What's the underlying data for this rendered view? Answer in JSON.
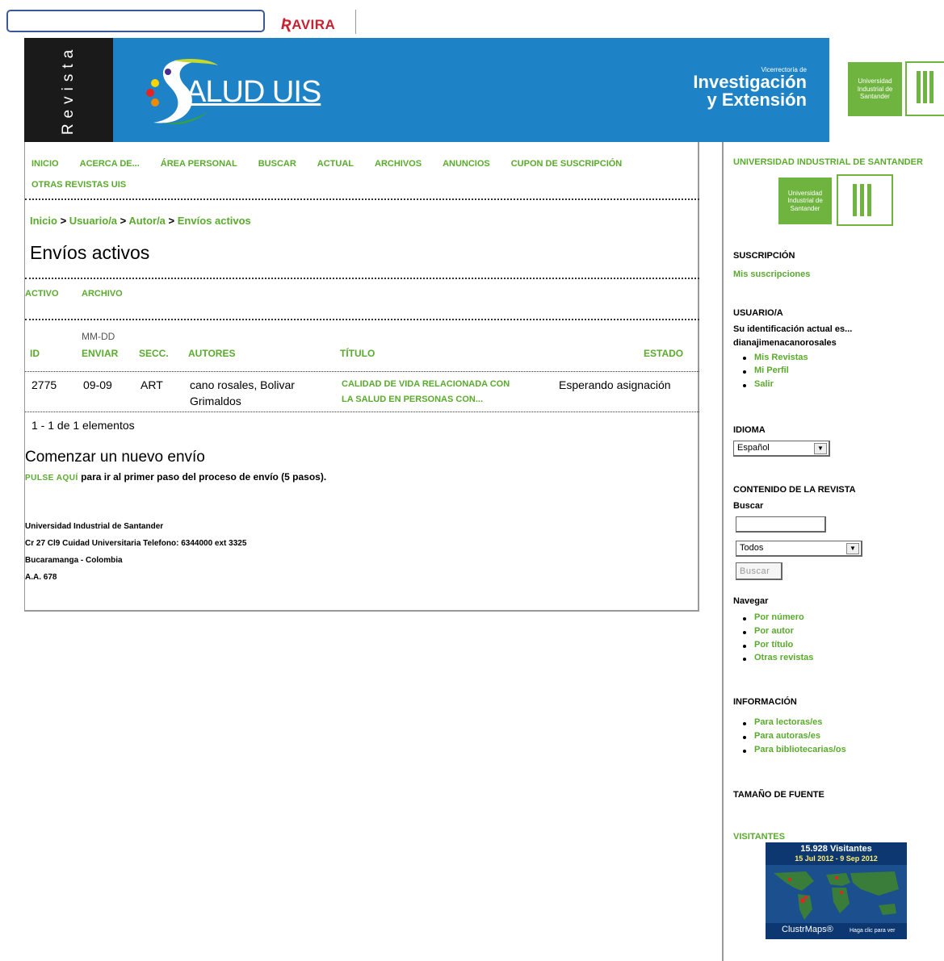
{
  "toolbar": {
    "search_value": "",
    "brand": "AVIRA",
    "brand_initial": "Ʀ"
  },
  "header": {
    "revista": "Revista",
    "logo_text": "ALUD UIS",
    "vie_small": "Vicerrectoría de",
    "vie_line1": "Investigación",
    "vie_line2": "y Extensión",
    "uis_logo": [
      "Universidad",
      "Industrial de",
      "Santander"
    ]
  },
  "nav": [
    "INICIO",
    "ACERCA DE...",
    "ÁREA PERSONAL",
    "BUSCAR",
    "ACTUAL",
    "ARCHIVOS",
    "ANUNCIOS",
    "CUPON DE SUSCRIPCIÓN",
    "OTRAS REVISTAS UIS"
  ],
  "breadcrumb": {
    "inicio": "Inicio",
    "usuario": "Usuario/a",
    "autor": "Autor/a",
    "current": "Envíos activos",
    "sep": ">"
  },
  "page_title": "Envíos activos",
  "tabs": {
    "activo": "ACTIVO",
    "archivo": "ARCHIVO"
  },
  "table": {
    "headers": {
      "id": "ID",
      "mmdd": "MM-DD",
      "enviar": "ENVIAR",
      "secc": "SECC.",
      "autores": "AUTORES",
      "titulo": "TÍTULO",
      "estado": "ESTADO"
    },
    "rows": [
      {
        "id": "2775",
        "date": "09-09",
        "secc": "ART",
        "autores1": "cano rosales, Bolivar",
        "autores2": "Grimaldos",
        "titulo1": "CALIDAD DE VIDA RELACIONADA CON",
        "titulo2": "LA SALUD EN PERSONAS CON...",
        "estado": "Esperando asignación"
      }
    ],
    "count": "1 - 1 de 1 elementos"
  },
  "new_submission": {
    "title": "Comenzar un nuevo envío",
    "link": "PULSE AQUÍ",
    "text": " para ir al primer paso del proceso de envío (5 pasos)."
  },
  "footer": [
    "Universidad Industrial de Santander",
    "Cr 27 Cl9 Cuidad Universitaria Telefono: 6344000 ext 3325",
    "Bucaramanga - Colombia",
    "A.A. 678"
  ],
  "sidebar": {
    "uis_title": "UNIVERSIDAD INDUSTRIAL DE SANTANDER",
    "uis_logo": [
      "Universidad",
      "Industrial de",
      "Santander"
    ],
    "suscripcion": "SUSCRIPCIÓN",
    "mis_suscripciones": "Mis suscripciones",
    "usuario": "USUARIO/A",
    "identificacion": "Su identificación actual es...",
    "username": "dianajimenacanorosales",
    "user_links": [
      "Mis Revistas",
      "Mi Perfil",
      "Salir"
    ],
    "idioma": "IDIOMA",
    "idioma_value": "Español",
    "contenido": "CONTENIDO DE LA REVISTA",
    "buscar_label": "Buscar",
    "buscar_value": "",
    "buscar_scope": "Todos",
    "buscar_button": "Buscar",
    "navegar": "Navegar",
    "navegar_links": [
      "Por número",
      "Por autor",
      "Por título",
      "Otras revistas"
    ],
    "informacion": "INFORMACIÓN",
    "info_links": [
      "Para lectoras/es",
      "Para autoras/es",
      "Para bibliotecarias/os"
    ],
    "fuente": "TAMAÑO DE FUENTE",
    "visitantes": "VISITANTES",
    "clustr_count": "15.928 Visitantes",
    "clustr_dates": "15 Jul 2012 - 9 Sep 2012",
    "clustr_brand": "ClustrMaps®",
    "clustr_click": "Haga clic para ver"
  }
}
